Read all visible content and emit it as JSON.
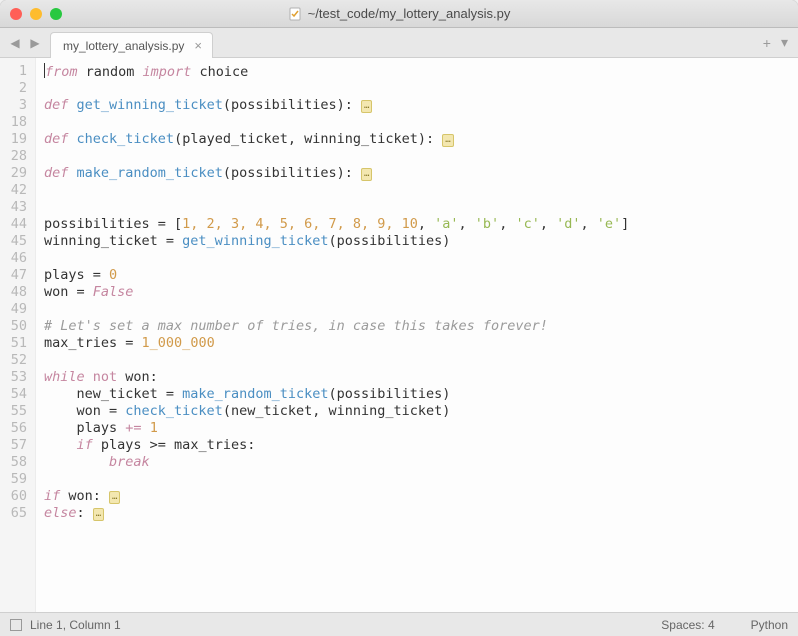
{
  "window": {
    "title": "~/test_code/my_lottery_analysis.py"
  },
  "tab": {
    "label": "my_lottery_analysis.py"
  },
  "gutter_lines": [
    "1",
    "2",
    "3",
    "18",
    "19",
    "28",
    "29",
    "42",
    "43",
    "44",
    "45",
    "46",
    "47",
    "48",
    "49",
    "50",
    "51",
    "52",
    "53",
    "54",
    "55",
    "56",
    "57",
    "58",
    "59",
    "60",
    "65"
  ],
  "code": {
    "l1_from": "from",
    "l1_random": " random ",
    "l1_import": "import",
    "l1_choice": " choice",
    "l3_def": "def",
    "l3_fn": "get_winning_ticket",
    "l3_rest": "(possibilities): ",
    "l19_def": "def",
    "l19_fn": "check_ticket",
    "l19_rest": "(played_ticket, winning_ticket): ",
    "l29_def": "def",
    "l29_fn": "make_random_ticket",
    "l29_rest": "(possibilities): ",
    "l44_a": "possibilities = [",
    "l44_nums": "1, 2, 3, 4, 5, 6, 7, 8, 9, 10",
    "l44_b": ", ",
    "l44_s1": "'a'",
    "l44_s2": "'b'",
    "l44_s3": "'c'",
    "l44_s4": "'d'",
    "l44_s5": "'e'",
    "l44_end": "]",
    "l45_a": "winning_ticket = ",
    "l45_fn": "get_winning_ticket",
    "l45_b": "(possibilities)",
    "l47_a": "plays = ",
    "l47_n": "0",
    "l48_a": "won = ",
    "l48_b": "False",
    "l50": "# Let's set a max number of tries, in case this takes forever!",
    "l51_a": "max_tries = ",
    "l51_n": "1_000_000",
    "l53_while": "while",
    "l53_not": "not",
    "l53_rest": " won:",
    "l54_a": "    new_ticket = ",
    "l54_fn": "make_random_ticket",
    "l54_b": "(possibilities)",
    "l55_a": "    won = ",
    "l55_fn": "check_ticket",
    "l55_b": "(new_ticket, winning_ticket)",
    "l56_a": "    plays ",
    "l56_op": "+=",
    "l56_sp": " ",
    "l56_n": "1",
    "l57_if": "    if",
    "l57_rest": " plays >= max_tries:",
    "l58_ind": "        ",
    "l58_break": "break",
    "l60_if": "if",
    "l60_rest": " won: ",
    "l65_else": "else",
    "l65_rest": ": ",
    "fold": "…"
  },
  "status": {
    "position": "Line 1, Column 1",
    "spaces": "Spaces: 4",
    "lang": "Python"
  }
}
